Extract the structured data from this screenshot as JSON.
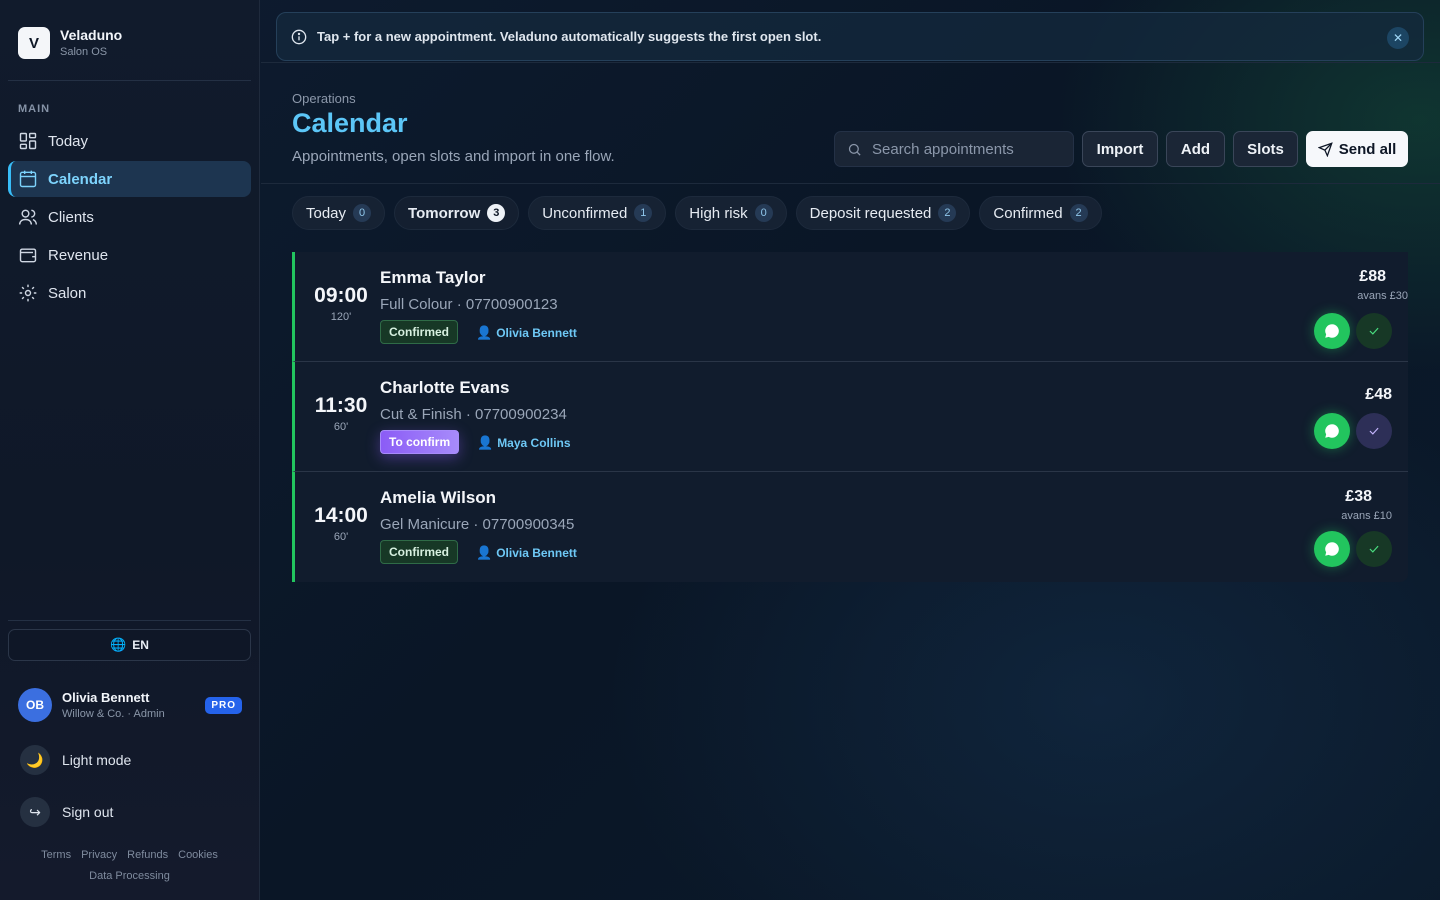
{
  "brand": {
    "initial": "V",
    "name": "Veladuno",
    "subtitle": "Salon OS"
  },
  "sidebar": {
    "section_label": "MAIN",
    "items": [
      {
        "label": "Today",
        "icon": "grid-icon"
      },
      {
        "label": "Calendar",
        "icon": "calendar-icon",
        "active": true
      },
      {
        "label": "Clients",
        "icon": "users-icon"
      },
      {
        "label": "Revenue",
        "icon": "wallet-icon"
      },
      {
        "label": "Salon",
        "icon": "gear-icon"
      }
    ],
    "language": "EN",
    "user": {
      "initials": "OB",
      "name": "Olivia Bennett",
      "role": "Willow & Co. · Admin",
      "badge": "PRO"
    },
    "light_mode": "Light mode",
    "sign_out": "Sign out",
    "footer_links": [
      "Terms",
      "Privacy",
      "Refunds",
      "Cookies",
      "Data Processing"
    ]
  },
  "banner": {
    "text": "Tap + for a new appointment. Veladuno automatically suggests the first open slot."
  },
  "header": {
    "breadcrumb": "Operations",
    "title": "Calendar",
    "subtitle": "Appointments, open slots and import in one flow.",
    "search_placeholder": "Search appointments",
    "buttons": {
      "import": "Import",
      "add": "Add",
      "slots": "Slots",
      "send_all": "Send all"
    }
  },
  "tabs": [
    {
      "label": "Today",
      "count": "0"
    },
    {
      "label": "Tomorrow",
      "count": "3",
      "active": true
    },
    {
      "label": "Unconfirmed",
      "count": "1"
    },
    {
      "label": "High risk",
      "count": "0"
    },
    {
      "label": "Deposit requested",
      "count": "2"
    },
    {
      "label": "Confirmed",
      "count": "2"
    }
  ],
  "appointments": [
    {
      "time": "09:00",
      "duration": "120'",
      "client": "Emma Taylor",
      "service": "Full Colour · 07700900123",
      "status": "Confirmed",
      "staff": "Olivia Bennett",
      "price": "£88",
      "deposit": "avans £30"
    },
    {
      "time": "11:30",
      "duration": "60'",
      "client": "Charlotte Evans",
      "service": "Cut & Finish · 07700900234",
      "status": "To confirm",
      "staff": "Maya Collins",
      "price": "£48",
      "deposit": ""
    },
    {
      "time": "14:00",
      "duration": "60'",
      "client": "Amelia Wilson",
      "service": "Gel Manicure · 07700900345",
      "status": "Confirmed",
      "staff": "Olivia Bennett",
      "price": "£38",
      "deposit": "avans £10"
    }
  ],
  "colors": {
    "accent": "#5cc6f7",
    "confirmed": "#22c55e",
    "pending": "#8b5cf6",
    "pro": "#2563eb"
  }
}
